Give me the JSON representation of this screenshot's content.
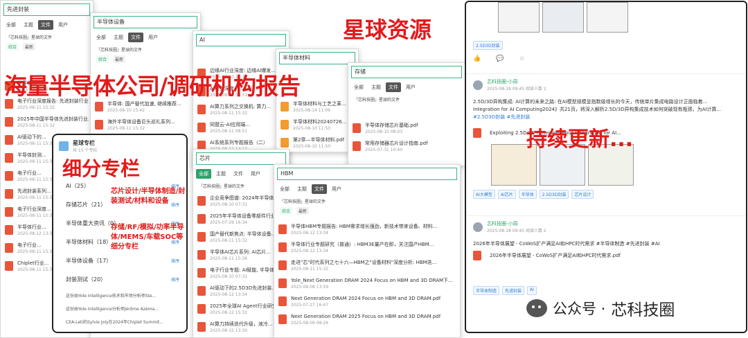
{
  "panel1": {
    "search": "先进封装",
    "tabs": [
      "全部",
      "主题",
      "文件",
      "用户"
    ],
    "circle": "「芯科技圈」星球的文件",
    "chips": [
      "综合",
      "最新"
    ],
    "items": [
      {
        "title": "半导体...",
        "date": "2025-07-29 16:40"
      },
      {
        "title": "电子行业深度报告: 先进封装行业...",
        "date": "2025-08-11 15:32"
      },
      {
        "title": "2025年中国半导体先进封装行业...",
        "date": "2025-08-11 15:32"
      },
      {
        "title": "AI驱动下的...",
        "date": "2025-08-11 15:32"
      },
      {
        "title": "半导体封测...",
        "date": "2025-08-11 15:32"
      },
      {
        "title": "电子行业...",
        "date": "2025-08-11 15:32"
      },
      {
        "title": "先进封装系列...",
        "date": "2025-08-11 15:32"
      },
      {
        "title": "电子行业深度...",
        "date": "2025-08-11 15:32"
      },
      {
        "title": "半导体行业...",
        "date": "2025-08-12 13:34"
      },
      {
        "title": "电子行业...",
        "date": "2025-08-11 15:32"
      },
      {
        "title": "Chiplet行业...",
        "date": "2025-08-11 15:32"
      }
    ]
  },
  "panel2": {
    "search": "半导体设备",
    "tabs": [
      "全部",
      "主题",
      "文件",
      "用户"
    ],
    "circle": "「芯科技圈」星球的文件",
    "chips": [
      "综合",
      "最新"
    ],
    "items": [
      {
        "title": "半导体: 国产替代加速, 继续推荐...",
        "date": "2025-08-10 15:42"
      },
      {
        "title": "海外半导体设备巨头巡礼系列...",
        "date": "2025-08-11 15:32"
      }
    ]
  },
  "panel3": {
    "search": "AI",
    "items": [
      {
        "title": "边缘AI行业深度: 边缘AI爆发...",
        "date": "2025-08-10 15:33"
      },
      {
        "title": "AI行业深度: ...",
        "date": "2025-08-11 08:51"
      },
      {
        "title": "AI算力系列之交换机: 算力...",
        "date": "2025-08-11 15:32"
      },
      {
        "title": "同盟云-AI应用端...",
        "date": "2025-08-11 08:51"
      },
      {
        "title": "AI系统系列专题报告（二）",
        "date": "2025-08-12 14:17"
      }
    ]
  },
  "panel4": {
    "search": "半导体材料",
    "items": [
      {
        "title": "半导体材料与工艺之革...",
        "date": "2025-08-14 11:06"
      },
      {
        "title": "半导体材料20240726...",
        "date": "2025-08-10 11:50"
      },
      {
        "title": "第2章—半导体材料.pdf",
        "date": "2025-08-10 11:50"
      }
    ]
  },
  "panel5": {
    "search": "存储",
    "tabs": [
      "全部",
      "主题",
      "文件",
      "用户"
    ],
    "circle": "「芯科技圈」星球的文件",
    "items": [
      {
        "title": "半导体存储芯片基础.pdf",
        "date": "2025-08-10 08:03"
      },
      {
        "title": "常用存储器芯片设计指南.pdf",
        "date": "2025-07-31 10:40"
      }
    ]
  },
  "panel6": {
    "search": "芯片",
    "tabs": [
      "全部",
      "主题",
      "文件",
      "用户"
    ],
    "circle": "「芯科技圈」星球的文件",
    "items": [
      {
        "title": "企业竞争图谱: 2024年半导体...",
        "date": "2025-08-10 07:31"
      },
      {
        "title": "2025年半导体设备零部件行业...",
        "date": "2025-07-29 16:34"
      },
      {
        "title": "国产替代新焦点: 半导体设备...",
        "date": "2025-08-11 15:32"
      },
      {
        "title": "半导体AI芯片系列: AI芯片...",
        "date": "2025-08-11 15:36"
      },
      {
        "title": "电子行业专题: AI赋能, 半导体...",
        "date": "2025-08-10 07:31"
      },
      {
        "title": "AI驱动下的2.5D3D先进封装...",
        "date": "2025-08-12 13:34"
      },
      {
        "title": "2025年全球AI Agent行业研究报告",
        "date": "2025-08-12 15:32"
      },
      {
        "title": "AI算力持续迭代升级，液冷...",
        "date": "2025-08-15 13:30"
      }
    ]
  },
  "panel7": {
    "search": "HBM",
    "tabs": [
      "全部",
      "主题",
      "文件",
      "用户"
    ],
    "circle": "「芯科技圈」星球的文件",
    "chips": [
      "综合",
      "最新"
    ],
    "items": [
      {
        "title": "半导体HBM专题报告: HBM需求增长强劲，新技术带来设备、材料...",
        "date": "2025-08-12 13:34"
      },
      {
        "title": "半导体行业专题研究（普通）: HBM3E量产在即，关注国产HBM...",
        "date": "2025-08-12 13:34"
      },
      {
        "title": "走进\"芯\"时代系列之七十六—HBM之\"设备材料\"深度分析: HBM迭...",
        "date": "2025-08-11 15:32"
      },
      {
        "title": "Yole_Next Generation DRAM 2024 Focus on HBM and 3D DRAM下...",
        "date": "2025-08-08 13:59"
      },
      {
        "title": "Next Generation DRAM 2024 Focus on HBM and 3D DRAM.pdf",
        "date": "2025-07-27 16:47"
      },
      {
        "title": "Next Generation DRAM 2025 Focus on HBM and 3D DRAM.pdf",
        "date": "2025-08-09 08:26"
      }
    ]
  },
  "column": {
    "title": "星球专栏",
    "count": "共 15 个专栏",
    "sort": "排序",
    "rows": [
      {
        "name": "AI（25）"
      },
      {
        "name": "存储芯片（21）"
      },
      {
        "name": "半导体重大资讯（0）"
      },
      {
        "name": "半导体材料（18）"
      },
      {
        "name": "半导体设备（17）"
      },
      {
        "name": "封装测试（20）"
      }
    ],
    "sub": [
      "这份由Yole Intelligence技术和市场分析师Ste...",
      "这份由Yole Intelligence分析师Jérôme Azéma...",
      "CEA-Leti的Sylvie Joly在2024年Chiplet Summit..."
    ]
  },
  "feed": {
    "post1": {
      "tags": [
        "2.5D3D封装"
      ],
      "actions": [
        "👍",
        "💬",
        "☆"
      ]
    },
    "post2": {
      "name": "芯科技圈-小周",
      "date": "2025-08-18 09:45 阅读人数 2",
      "text1": "2.5D/3D异构集成: AI计算的未来之路: 在AI模型规模呈指数级增长的今天，传统单片集成电路设计正面临着...",
      "text2": "Integration for AI Computing2024》共21页，将深入解析2.5D/3D异构集成技术如何突破现有瓶颈，为AI计算...",
      "hashtags": "#2.5D3D封装 #先进封装",
      "file": "Exploiting 2.5D/3D Heterogeneous Integration for AI...",
      "tags": [
        "AI大模型",
        "AI芯片",
        "半导体",
        "2.5D3D封装",
        "芯片设计"
      ]
    },
    "post3": {
      "name": "芯科技圈-小周",
      "date": "2025-08-18 09:45 阅读人数 2",
      "text": "2026年半导体展望 - CoWoS扩产满足AI和HPC时代需求 #半导体制造 #先进封装 #AI",
      "file": "2026年半导体展望 - CoWoS扩产满足AI和HPC时代需求.pdf",
      "tags": [
        "半导体制造",
        "先进封装",
        "AI"
      ]
    }
  },
  "overlays": {
    "planet": "星球资源",
    "reports": "海量半导体公司/调研机构报告",
    "column": "细分专栏",
    "update": "持续更新...",
    "cats1": "芯片设计/半导体制造/封装测试/材料和设备",
    "cats2": "存储/RF/模拟/功率半导体/MEMS/车载SOC等细分专栏"
  },
  "watermark": {
    "prefix": "公众号 · ",
    "name": "芯科技圈"
  }
}
